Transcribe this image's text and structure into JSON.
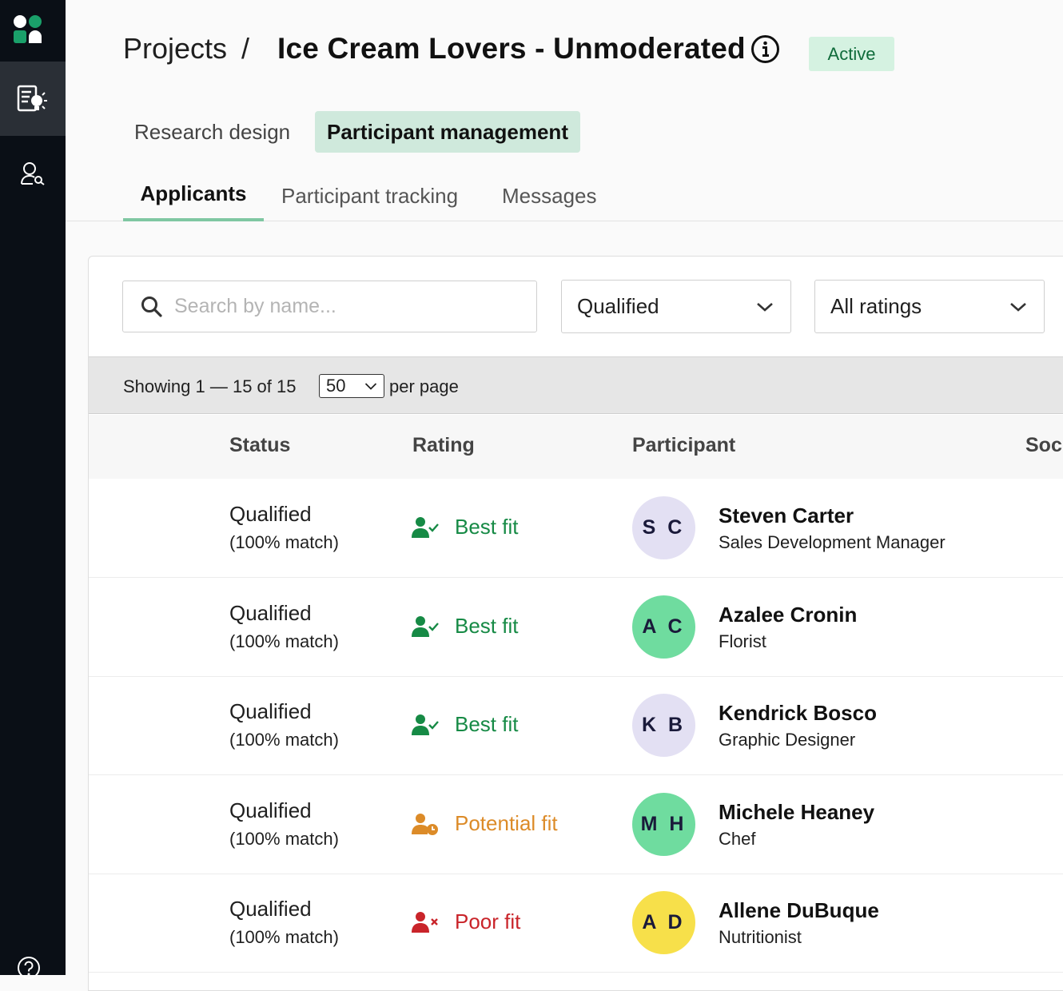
{
  "sidebar": {
    "items": [
      {
        "name": "projects",
        "icon": "research-project-icon"
      },
      {
        "name": "people",
        "icon": "user-search-icon"
      }
    ],
    "help_icon": "help-icon"
  },
  "header": {
    "breadcrumb_root": "Projects",
    "breadcrumb_separator": "/",
    "title": "Ice Cream Lovers - Unmoderated",
    "status": "Active"
  },
  "tabs": [
    {
      "label": "Research design",
      "active": false
    },
    {
      "label": "Participant management",
      "active": true
    }
  ],
  "subtabs": [
    {
      "label": "Applicants",
      "active": true
    },
    {
      "label": "Participant tracking",
      "active": false
    },
    {
      "label": "Messages",
      "active": false
    }
  ],
  "filters": {
    "search_placeholder": "Search by name...",
    "search_value": "",
    "status_filter": "Qualified",
    "rating_filter": "All ratings"
  },
  "pagination": {
    "showing": "Showing 1 — 15 of 15",
    "per_page_value": "50",
    "per_page_label": "per page"
  },
  "table": {
    "columns": [
      "Status",
      "Rating",
      "Participant",
      "Soc"
    ],
    "rows": [
      {
        "status": "Qualified",
        "match": "(100% match)",
        "rating": "Best fit",
        "rating_kind": "best",
        "initials": "S C",
        "name": "Steven Carter",
        "title": "Sales Development Manager",
        "avatar_color": "#e3e0f3"
      },
      {
        "status": "Qualified",
        "match": "(100% match)",
        "rating": "Best fit",
        "rating_kind": "best",
        "initials": "A C",
        "name": "Azalee Cronin",
        "title": "Florist",
        "avatar_color": "#6fdc9f"
      },
      {
        "status": "Qualified",
        "match": "(100% match)",
        "rating": "Best fit",
        "rating_kind": "best",
        "initials": "K B",
        "name": "Kendrick Bosco",
        "title": "Graphic Designer",
        "avatar_color": "#e3e0f3"
      },
      {
        "status": "Qualified",
        "match": "(100% match)",
        "rating": "Potential fit",
        "rating_kind": "potential",
        "initials": "M H",
        "name": "Michele Heaney",
        "title": "Chef",
        "avatar_color": "#6fdc9f"
      },
      {
        "status": "Qualified",
        "match": "(100% match)",
        "rating": "Poor fit",
        "rating_kind": "poor",
        "initials": "A D",
        "name": "Allene DuBuque",
        "title": "Nutritionist",
        "avatar_color": "#f7e04a"
      }
    ]
  },
  "colors": {
    "best": "#168a45",
    "potential": "#dc8b28",
    "poor": "#c9242a",
    "accent": "#7fc7a2",
    "sidebar": "#0a0f16"
  }
}
